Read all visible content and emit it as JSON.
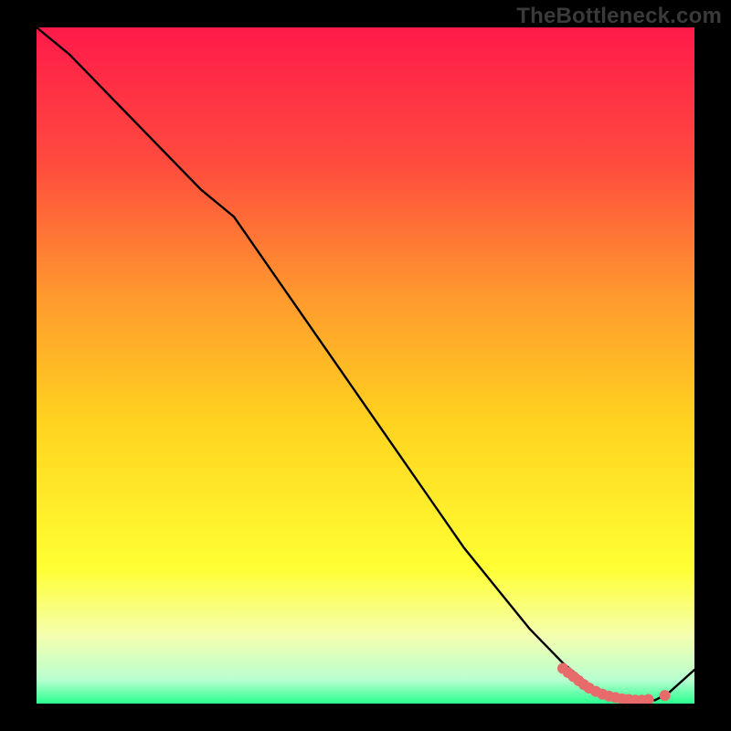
{
  "watermark": "TheBottleneck.com",
  "chart_data": {
    "type": "line",
    "title": "",
    "xlabel": "",
    "ylabel": "",
    "xlim": [
      0,
      100
    ],
    "ylim": [
      0,
      100
    ],
    "grid": false,
    "legend": false,
    "background": {
      "type": "vertical-gradient",
      "stops": [
        {
          "pos": 0.0,
          "color": "#ff1a4a"
        },
        {
          "pos": 0.2,
          "color": "#ff4b3e"
        },
        {
          "pos": 0.4,
          "color": "#ff9a2e"
        },
        {
          "pos": 0.58,
          "color": "#ffd21f"
        },
        {
          "pos": 0.8,
          "color": "#ffff33"
        },
        {
          "pos": 0.9,
          "color": "#f4ffb0"
        },
        {
          "pos": 0.965,
          "color": "#b8ffd0"
        },
        {
          "pos": 1.0,
          "color": "#2aff8f"
        }
      ]
    },
    "series": [
      {
        "name": "curve",
        "color": "#000000",
        "width": 2.4,
        "x": [
          0,
          5,
          10,
          15,
          20,
          25,
          30,
          35,
          40,
          45,
          50,
          55,
          60,
          65,
          70,
          75,
          80,
          85,
          90,
          94,
          96,
          100
        ],
        "y": [
          100,
          96,
          91,
          86,
          81,
          76,
          72,
          65,
          58,
          51,
          44,
          37,
          30,
          23,
          17,
          11,
          6,
          2,
          0.5,
          0.5,
          1.5,
          5
        ]
      }
    ],
    "markers": {
      "name": "highlight-segment",
      "color": "#e86b6b",
      "radius": 6,
      "points": [
        {
          "x": 80.0,
          "y": 5.2
        },
        {
          "x": 80.8,
          "y": 4.6
        },
        {
          "x": 81.6,
          "y": 4.0
        },
        {
          "x": 82.4,
          "y": 3.4
        },
        {
          "x": 83.2,
          "y": 2.8
        },
        {
          "x": 84.0,
          "y": 2.3
        },
        {
          "x": 85.0,
          "y": 1.8
        },
        {
          "x": 86.0,
          "y": 1.4
        },
        {
          "x": 87.0,
          "y": 1.1
        },
        {
          "x": 88.0,
          "y": 0.9
        },
        {
          "x": 89.0,
          "y": 0.7
        },
        {
          "x": 90.0,
          "y": 0.6
        },
        {
          "x": 91.0,
          "y": 0.5
        },
        {
          "x": 92.0,
          "y": 0.5
        },
        {
          "x": 93.0,
          "y": 0.6
        },
        {
          "x": 95.5,
          "y": 1.2
        }
      ]
    }
  }
}
